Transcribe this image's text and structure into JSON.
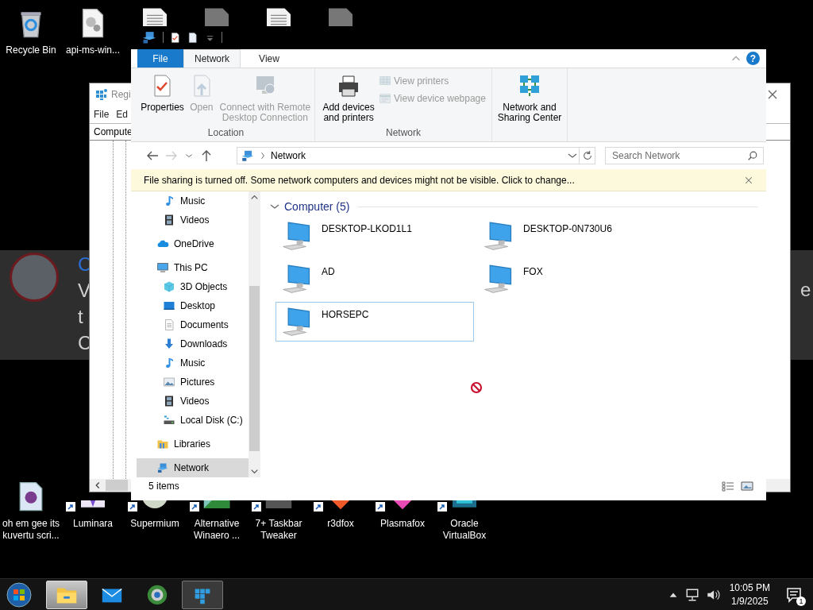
{
  "desktop_top_icons": [
    {
      "kind": "recycle-bin",
      "label": "Recycle Bin"
    },
    {
      "kind": "gear-file",
      "label": "api-ms-win..."
    },
    {
      "kind": "document"
    },
    {
      "kind": "dark-file"
    },
    {
      "kind": "document"
    },
    {
      "kind": "dark-file"
    }
  ],
  "quick_access_toolbar": [
    {
      "kind": "network"
    },
    {
      "kind": "properties"
    },
    {
      "kind": "page"
    },
    {
      "kind": "dropdown"
    }
  ],
  "notification": {
    "title": "C",
    "lines": [
      "V",
      "t",
      "C"
    ],
    "edge_text": "e"
  },
  "background_window": {
    "title": "Regi",
    "menu": [
      "File",
      "Ed"
    ],
    "column": "Compute"
  },
  "explorer": {
    "ribbon_tabs": [
      {
        "label": "File",
        "kind": "file",
        "selected": false
      },
      {
        "label": "Network",
        "kind": "tab",
        "selected": true
      },
      {
        "label": "View",
        "kind": "tab",
        "selected": false
      }
    ],
    "help_label": "?",
    "ribbon_groups": [
      {
        "label": "Location",
        "commands": [
          {
            "label": "Properties",
            "kind": "properties",
            "disabled": false
          },
          {
            "label": "Open",
            "kind": "open",
            "disabled": true
          },
          {
            "label": "Connect with Remote Desktop Connection",
            "kind": "remote",
            "disabled": true
          }
        ]
      },
      {
        "label": "Network",
        "commands": [
          {
            "label": "Add devices and printers",
            "kind": "printer",
            "disabled": false
          },
          {
            "label": "View printers",
            "kind": "grid",
            "disabled": true
          },
          {
            "label": "View device webpage",
            "kind": "webpage",
            "disabled": true
          }
        ]
      },
      {
        "commands": [
          {
            "label": "Network and Sharing Center",
            "kind": "sharing",
            "disabled": false
          }
        ]
      }
    ],
    "address": "Network",
    "search": {
      "placeholder": "Search Network"
    },
    "info_bar": "File sharing is turned off. Some network computers and devices might not be visible. Click to change...",
    "navigation": {
      "continued_items": [
        {
          "label": "Music",
          "kind": "music",
          "selected": false
        },
        {
          "label": "Videos",
          "kind": "videos",
          "selected": false
        }
      ],
      "items": [
        {
          "label": "OneDrive",
          "kind": "onedrive",
          "selected": false
        },
        {
          "label": "This PC",
          "kind": "this-pc",
          "selected": false,
          "children": [
            {
              "label": "3D Objects",
              "kind": "cube",
              "selected": false
            },
            {
              "label": "Desktop",
              "kind": "desktop",
              "selected": false
            },
            {
              "label": "Documents",
              "kind": "documents",
              "selected": false
            },
            {
              "label": "Downloads",
              "kind": "downloads",
              "selected": false
            },
            {
              "label": "Music",
              "kind": "music",
              "selected": false
            },
            {
              "label": "Pictures",
              "kind": "pictures",
              "selected": false
            },
            {
              "label": "Videos",
              "kind": "videos",
              "selected": false
            },
            {
              "label": "Local Disk (C:)",
              "kind": "disk",
              "selected": false
            }
          ]
        },
        {
          "label": "Libraries",
          "kind": "libraries",
          "selected": false
        },
        {
          "label": "Network",
          "kind": "network",
          "selected": true
        }
      ]
    },
    "group": {
      "label": "Computer (5)",
      "expanded": true
    },
    "computers": [
      {
        "name": "DESKTOP-LKOD1L1",
        "selected": false
      },
      {
        "name": "DESKTOP-0N730U6",
        "selected": false
      },
      {
        "name": "AD",
        "selected": false
      },
      {
        "name": "FOX",
        "selected": false
      },
      {
        "name": "HORSEPC",
        "selected": true
      }
    ],
    "status": "5 items"
  },
  "desktop_bottom_icons": [
    {
      "kind": "h-file",
      "label": "oh em gee its kuvertu scri...",
      "shortcut": false
    },
    {
      "kind": "luminara",
      "label": "Luminara",
      "shortcut": true
    },
    {
      "kind": "supermium",
      "label": "Supermium",
      "shortcut": true
    },
    {
      "kind": "winaero",
      "label": "Alternative Winaero ...",
      "shortcut": true
    },
    {
      "kind": "tweaker",
      "label": "7+ Taskbar Tweaker",
      "shortcut": true
    },
    {
      "kind": "r3dfox",
      "label": "r3dfox",
      "shortcut": true
    },
    {
      "kind": "plasmafox",
      "label": "Plasmafox",
      "shortcut": true
    },
    {
      "kind": "virtualbox",
      "label": "Oracle VirtualBox",
      "shortcut": true
    }
  ],
  "taskbar": {
    "apps": [
      {
        "kind": "explorer",
        "open": true,
        "focused": true
      },
      {
        "kind": "mail",
        "open": false,
        "focused": false
      },
      {
        "kind": "browser",
        "open": false,
        "focused": false
      },
      {
        "kind": "regedit",
        "open": true,
        "focused": false
      }
    ],
    "time": "10:05 PM",
    "date": "1/9/2025",
    "notification_count": "1"
  }
}
